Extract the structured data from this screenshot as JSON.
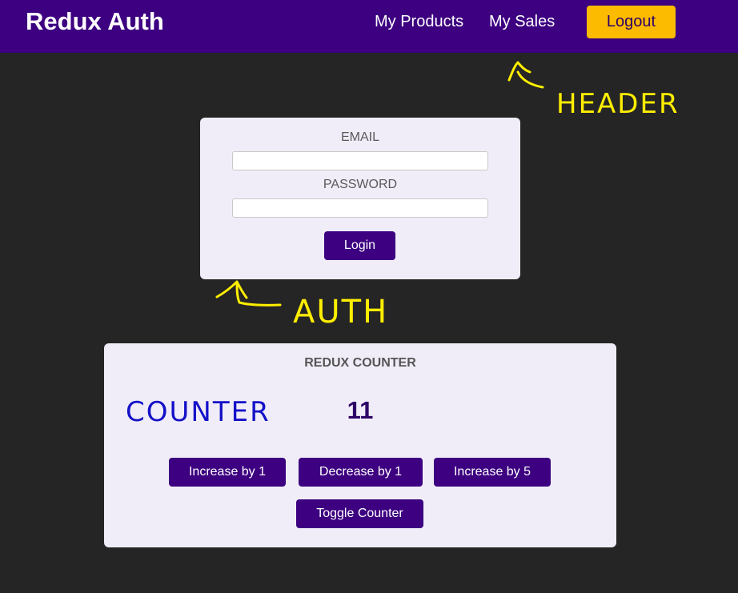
{
  "header": {
    "brand": "Redux Auth",
    "nav": {
      "products": "My Products",
      "sales": "My Sales"
    },
    "logout_label": "Logout"
  },
  "auth": {
    "email_label": "EMAIL",
    "email_value": "",
    "password_label": "PASSWORD",
    "password_value": "",
    "login_label": "Login"
  },
  "counter": {
    "title": "REDUX COUNTER",
    "value": "11",
    "buttons": {
      "increase_1": "Increase by 1",
      "decrease_1": "Decrease by 1",
      "increase_5": "Increase by 5",
      "toggle": "Toggle Counter"
    }
  },
  "annotations": {
    "header": "HEADER",
    "auth": "AUTH",
    "counter": "COUNTER"
  },
  "colors": {
    "header_bg": "#3c0080",
    "page_bg": "#252525",
    "card_bg": "#f0edf8",
    "logout_bg": "#fdbb00",
    "primary_button": "#3c0080",
    "annotation_yellow": "#ffee00",
    "annotation_blue": "#1410c8"
  }
}
